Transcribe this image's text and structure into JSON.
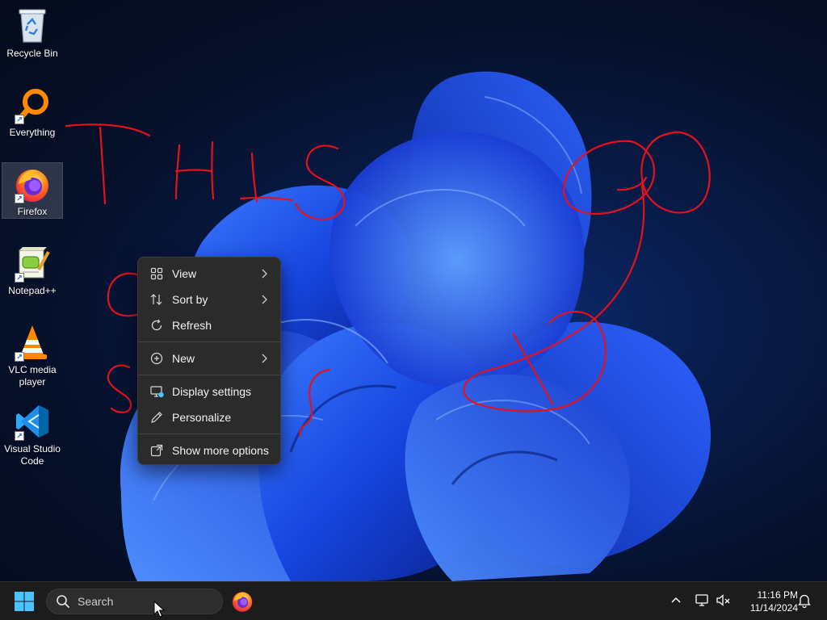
{
  "desktop": {
    "icons": [
      {
        "label": "Recycle Bin",
        "icon": "recycle-bin-icon"
      },
      {
        "label": "Everything",
        "icon": "everything-search-icon"
      },
      {
        "label": "Firefox",
        "icon": "firefox-icon"
      },
      {
        "label": "Notepad++",
        "icon": "notepad-plus-plus-icon"
      },
      {
        "label": "VLC media player",
        "icon": "vlc-icon"
      },
      {
        "label": "Visual Studio Code",
        "icon": "vscode-icon"
      }
    ],
    "handwriting": [
      "THIS",
      "GO"
    ],
    "ink_color": "#e3121c"
  },
  "context_menu": {
    "items": [
      {
        "label": "View",
        "icon": "grid-view-icon",
        "submenu": true
      },
      {
        "label": "Sort by",
        "icon": "sort-icon",
        "submenu": true
      },
      {
        "label": "Refresh",
        "icon": "refresh-icon",
        "submenu": false
      },
      {
        "label": "New",
        "icon": "plus-circle-icon",
        "submenu": true
      },
      {
        "label": "Display settings",
        "icon": "display-settings-icon",
        "submenu": false
      },
      {
        "label": "Personalize",
        "icon": "pen-icon",
        "submenu": false
      },
      {
        "label": "Show more options",
        "icon": "share-expand-icon",
        "submenu": false
      }
    ]
  },
  "taskbar": {
    "search_placeholder": "Search",
    "pinned": [
      "firefox-icon"
    ],
    "clock": {
      "time": "11:16 PM",
      "date": "11/14/2024"
    },
    "tray_icons": [
      "chevron-up-icon",
      "network-icon",
      "volume-muted-icon",
      "notification-bell-icon"
    ]
  },
  "colors": {
    "accent": "#0078d4",
    "menu_bg": "#2b2b2b",
    "taskbar_bg": "#1c1c1c"
  }
}
